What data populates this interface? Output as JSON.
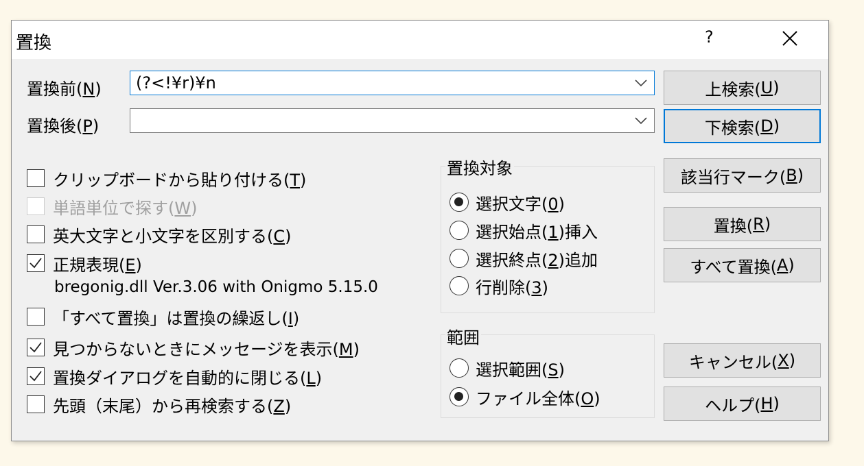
{
  "window": {
    "title": "置換",
    "help_glyph": "?"
  },
  "find": {
    "label": "置換前(",
    "key": "N",
    "label_end": ")",
    "value": "(?<!¥r)¥n"
  },
  "replace": {
    "label": "置換後(",
    "key": "P",
    "label_end": ")",
    "value": ""
  },
  "options": [
    {
      "pre": "クリップボードから貼り付ける(",
      "key": "T",
      "post": ")",
      "checked": false,
      "disabled": false
    },
    {
      "pre": "単語単位で探す(",
      "key": "W",
      "post": ")",
      "checked": false,
      "disabled": true
    },
    {
      "pre": "英大文字と小文字を区別する(",
      "key": "C",
      "post": ")",
      "checked": false,
      "disabled": false
    },
    {
      "pre": "正規表現(",
      "key": "E",
      "post": ")",
      "checked": true,
      "disabled": false
    },
    {
      "pre": "「すべて置換」は置換の繰返し(",
      "key": "I",
      "post": ")",
      "checked": false,
      "disabled": false
    },
    {
      "pre": "見つからないときにメッセージを表示(",
      "key": "M",
      "post": ")",
      "checked": true,
      "disabled": false
    },
    {
      "pre": "置換ダイアログを自動的に閉じる(",
      "key": "L",
      "post": ")",
      "checked": true,
      "disabled": false
    },
    {
      "pre": "先頭（末尾）から再検索する(",
      "key": "Z",
      "post": ")",
      "checked": false,
      "disabled": false
    }
  ],
  "regex_lib_info": "bregonig.dll Ver.3.06 with Onigmo 5.15.0",
  "target_group": {
    "title": "置換対象",
    "options": [
      {
        "pre": "選択文字(",
        "key": "0",
        "post": ")",
        "selected": true
      },
      {
        "pre": "選択始点(",
        "key": "1",
        "post": ")挿入",
        "selected": false
      },
      {
        "pre": "選択終点(",
        "key": "2",
        "post": ")追加",
        "selected": false
      },
      {
        "pre": "行削除(",
        "key": "3",
        "post": ")",
        "selected": false
      }
    ]
  },
  "scope_group": {
    "title": "範囲",
    "options": [
      {
        "pre": "選択範囲(",
        "key": "S",
        "post": ")",
        "selected": false
      },
      {
        "pre": "ファイル全体(",
        "key": "O",
        "post": ")",
        "selected": true
      }
    ]
  },
  "buttons": {
    "search_up": {
      "pre": "上検索(",
      "key": "U",
      "post": ")"
    },
    "search_down": {
      "pre": "下検索(",
      "key": "D",
      "post": ")"
    },
    "mark_lines": {
      "pre": "該当行マーク(",
      "key": "B",
      "post": ")"
    },
    "replace": {
      "pre": "置換(",
      "key": "R",
      "post": ")"
    },
    "replace_all": {
      "pre": "すべて置換(",
      "key": "A",
      "post": ")"
    },
    "cancel": {
      "pre": "キャンセル(",
      "key": "X",
      "post": ")"
    },
    "help": {
      "pre": "ヘルプ(",
      "key": "H",
      "post": ")"
    }
  }
}
